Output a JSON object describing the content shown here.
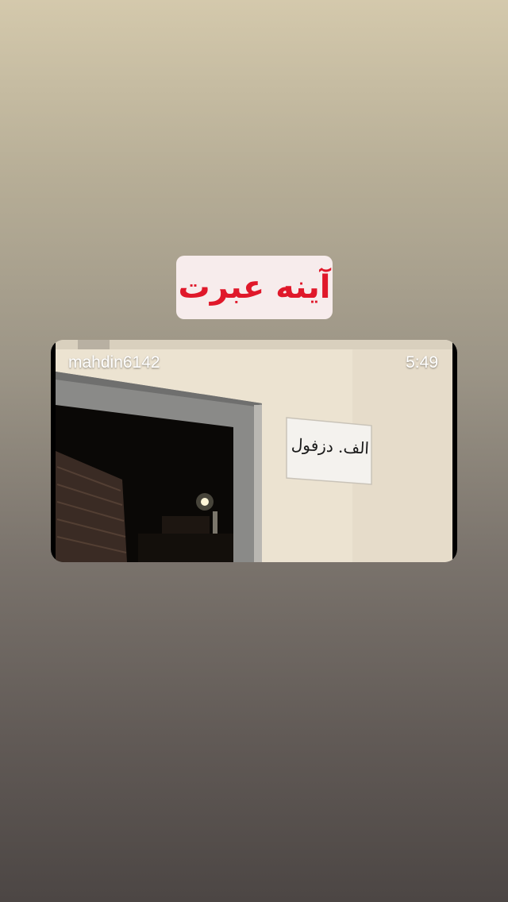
{
  "story": {
    "title": "آینه عبرت",
    "title_color": "#e0182a",
    "title_bg": "#f7ecec"
  },
  "video": {
    "username": "mahdin6142",
    "duration": "5:49",
    "sign_text": "الف. دزفول"
  }
}
